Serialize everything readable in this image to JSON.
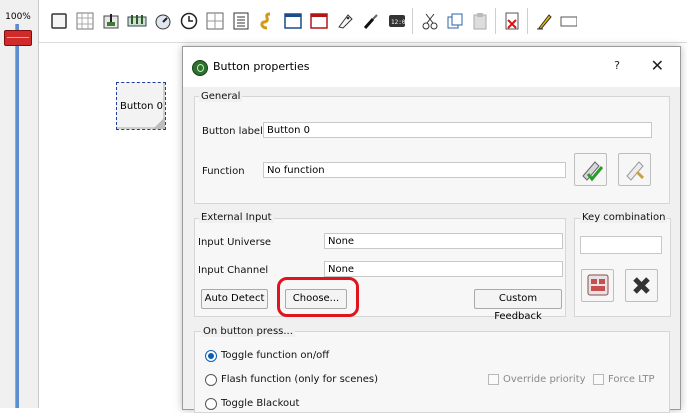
{
  "left_panel": {
    "zoom_label": "100%",
    "slider_color": "#d02a2a"
  },
  "toolbar": {
    "icons": [
      "button-icon",
      "button-matrix-icon",
      "slider-icon",
      "slider-matrix-icon",
      "knob-icon",
      "speed-dial-icon",
      "xy-pad-icon",
      "cue-list-icon",
      "audio-triggers-icon",
      "frame-icon",
      "solo-frame-icon",
      "label-icon",
      "animation-icon",
      "clock-icon",
      "cut-icon",
      "copy-icon",
      "paste-icon",
      "delete-icon",
      "edit-icon",
      "label-edit-icon"
    ]
  },
  "workarea": {
    "vc_button_label": "Button 0"
  },
  "dialog": {
    "title": "Button properties",
    "help": "?",
    "close": "✕",
    "general": {
      "title": "General",
      "button_label_caption": "Button label",
      "button_label_value": "Button 0",
      "function_caption": "Function",
      "function_value": "No function"
    },
    "external_input": {
      "title": "External Input",
      "universe_caption": "Input Universe",
      "universe_value": "None",
      "channel_caption": "Input Channel",
      "channel_value": "None",
      "auto_detect": "Auto Detect",
      "choose": "Choose...",
      "custom_feedback": "Custom Feedback"
    },
    "key_combination": {
      "title": "Key combination",
      "value": ""
    },
    "on_press": {
      "title": "On button press...",
      "options": [
        "Toggle function on/off",
        "Flash function (only for scenes)",
        "Toggle Blackout"
      ],
      "selected_index": 0,
      "override_priority": "Override priority",
      "force_ltp": "Force LTP"
    },
    "highlight_color": "#e0141c"
  }
}
